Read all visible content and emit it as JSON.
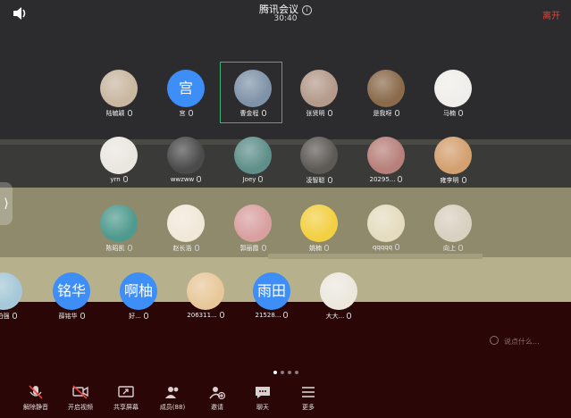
{
  "meeting": {
    "title": "腾讯会议",
    "timer": "30:40",
    "leave_label": "离开"
  },
  "participants": [
    {
      "name": "陆毓颖",
      "avatar": "photo",
      "color": "#c9b7a0"
    },
    {
      "name": "宫",
      "avatar": "text",
      "avatar_text": "宫"
    },
    {
      "name": "曹金程",
      "avatar": "photo",
      "color": "#7f93a8"
    },
    {
      "name": "张贤明",
      "avatar": "photo",
      "color": "#b49a8a"
    },
    {
      "name": "是我呀",
      "avatar": "photo",
      "color": "#8a6a4a"
    },
    {
      "name": "马楠",
      "avatar": "photo",
      "color": "#f0eeea"
    },
    {
      "name": "yrn",
      "avatar": "photo",
      "color": "#eae6e0"
    },
    {
      "name": "wwzww",
      "avatar": "photo",
      "color": "#4b4b4b"
    },
    {
      "name": "Joey",
      "avatar": "photo",
      "color": "#5f8f8a"
    },
    {
      "name": "凌智聪",
      "avatar": "photo",
      "color": "#5d5a55"
    },
    {
      "name": "20295...",
      "avatar": "photo",
      "color": "#b8807a"
    },
    {
      "name": "雍李明",
      "avatar": "photo",
      "color": "#d3a070"
    },
    {
      "name": "陈昭凯",
      "avatar": "photo",
      "color": "#4f9a8e"
    },
    {
      "name": "赵长浩",
      "avatar": "photo",
      "color": "#f1e8d8"
    },
    {
      "name": "郭丽霞",
      "avatar": "photo",
      "color": "#d9a0a0"
    },
    {
      "name": "姚楠",
      "avatar": "photo",
      "color": "#f3d043"
    },
    {
      "name": "qqqqq",
      "avatar": "photo",
      "color": "#e5dcc0"
    },
    {
      "name": "向上",
      "avatar": "photo",
      "color": "#d8d0c0"
    },
    {
      "name": "谢柏强",
      "avatar": "photo",
      "color": "#a6c8d8"
    },
    {
      "name": "薛铭华",
      "avatar": "text",
      "avatar_text": "铭华"
    },
    {
      "name": "好...",
      "avatar": "text",
      "avatar_text": "啊柚"
    },
    {
      "name": "206311...",
      "avatar": "photo",
      "color": "#e8c89a"
    },
    {
      "name": "21528...",
      "avatar": "text",
      "avatar_text": "雨田"
    },
    {
      "name": "大大...",
      "avatar": "photo",
      "color": "#ece8de"
    }
  ],
  "chat_input": {
    "placeholder": "说点什么..."
  },
  "pagination": {
    "total": 4,
    "current": 1
  },
  "toolbar": [
    {
      "label": "解除静音",
      "icon": "mic-muted-icon"
    },
    {
      "label": "开启视频",
      "icon": "video-off-icon"
    },
    {
      "label": "共享屏幕",
      "icon": "share-screen-icon"
    },
    {
      "label": "成员(88)",
      "icon": "members-icon"
    },
    {
      "label": "邀请",
      "icon": "invite-icon"
    },
    {
      "label": "聊天",
      "icon": "chat-icon"
    },
    {
      "label": "更多",
      "icon": "more-icon"
    }
  ],
  "colors": {
    "accent_blue": "#3d8ef6",
    "leave_red": "#e5433a",
    "active_green": "#3cb371"
  }
}
